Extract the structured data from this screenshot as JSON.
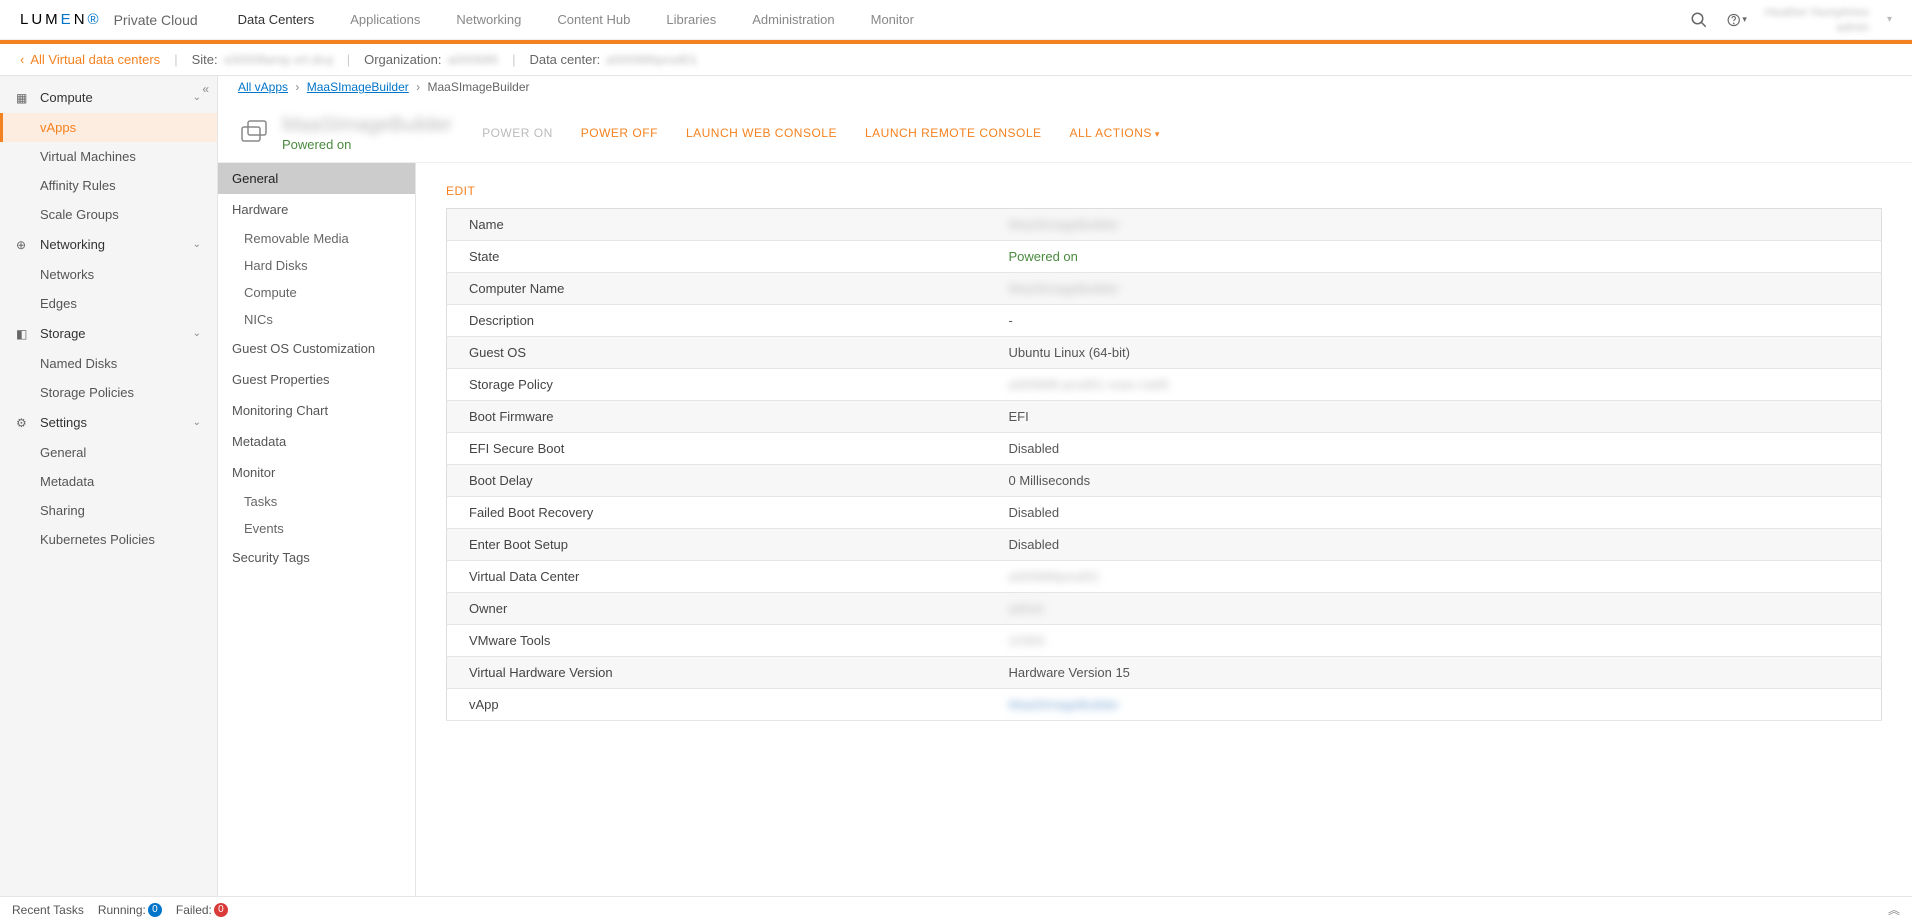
{
  "brand": {
    "name": "LUMEN",
    "product": "Private Cloud"
  },
  "topnav": {
    "items": [
      "Data Centers",
      "Applications",
      "Networking",
      "Content Hub",
      "Libraries",
      "Administration",
      "Monitor"
    ],
    "active": 0
  },
  "user": {
    "display": "Heather Humphries",
    "sub": "admin"
  },
  "context": {
    "back": "All Virtual data centers",
    "site_label": "Site:",
    "site_value": "s0000llamp.vrt.dcq",
    "org_label": "Organization:",
    "org_value": "a000686",
    "dc_label": "Data center:",
    "dc_value": "a000686prod01"
  },
  "sidebar": {
    "groups": [
      {
        "label": "Compute",
        "icon": "grid",
        "items": [
          "vApps",
          "Virtual Machines",
          "Affinity Rules",
          "Scale Groups"
        ],
        "active": 0
      },
      {
        "label": "Networking",
        "icon": "net",
        "items": [
          "Networks",
          "Edges"
        ]
      },
      {
        "label": "Storage",
        "icon": "disk",
        "items": [
          "Named Disks",
          "Storage Policies"
        ]
      },
      {
        "label": "Settings",
        "icon": "gear",
        "items": [
          "General",
          "Metadata",
          "Sharing",
          "Kubernetes Policies"
        ]
      }
    ]
  },
  "breadcrumb": {
    "items": [
      {
        "label": "All vApps",
        "link": true
      },
      {
        "label": "MaaSImageBuilder",
        "link": true
      },
      {
        "label": "MaaSImageBuilder",
        "link": false
      }
    ]
  },
  "vm": {
    "name": "MaaSImageBuilder",
    "status": "Powered on",
    "actions": {
      "power_on": "POWER ON",
      "power_off": "POWER OFF",
      "launch_web": "LAUNCH WEB CONSOLE",
      "launch_remote": "LAUNCH REMOTE CONSOLE",
      "all": "ALL ACTIONS"
    }
  },
  "subnav": {
    "items": [
      {
        "label": "General",
        "active": true
      },
      {
        "label": "Hardware",
        "children": [
          "Removable Media",
          "Hard Disks",
          "Compute",
          "NICs"
        ]
      },
      {
        "label": "Guest OS Customization"
      },
      {
        "label": "Guest Properties"
      },
      {
        "label": "Monitoring Chart"
      },
      {
        "label": "Metadata"
      },
      {
        "label": "Monitor",
        "children": [
          "Tasks",
          "Events"
        ]
      },
      {
        "label": "Security Tags"
      }
    ]
  },
  "detail": {
    "edit": "EDIT",
    "rows": [
      {
        "k": "Name",
        "v": "MaaSImageBuilder",
        "blur": true
      },
      {
        "k": "State",
        "v": "Powered on",
        "green": true
      },
      {
        "k": "Computer Name",
        "v": "MaaSImageBuilder",
        "blur": true
      },
      {
        "k": "Description",
        "v": "-"
      },
      {
        "k": "Guest OS",
        "v": "Ubuntu Linux (64-bit)"
      },
      {
        "k": "Storage Policy",
        "v": "a000686-prod01-vsan-raid5",
        "blur": true
      },
      {
        "k": "Boot Firmware",
        "v": "EFI"
      },
      {
        "k": "EFI Secure Boot",
        "v": "Disabled"
      },
      {
        "k": "Boot Delay",
        "v": "0 Milliseconds"
      },
      {
        "k": "Failed Boot Recovery",
        "v": "Disabled"
      },
      {
        "k": "Enter Boot Setup",
        "v": "Disabled"
      },
      {
        "k": "Virtual Data Center",
        "v": "a000686prod01",
        "blur": true
      },
      {
        "k": "Owner",
        "v": "admin",
        "blur": true
      },
      {
        "k": "VMware Tools",
        "v": "10363",
        "blur": true
      },
      {
        "k": "Virtual Hardware Version",
        "v": "Hardware Version 15"
      },
      {
        "k": "vApp",
        "v": "MaaSImageBuilder",
        "linkblur": true
      }
    ]
  },
  "bottom": {
    "recent": "Recent Tasks",
    "running_label": "Running:",
    "running_count": "0",
    "failed_label": "Failed:",
    "failed_count": "0"
  }
}
